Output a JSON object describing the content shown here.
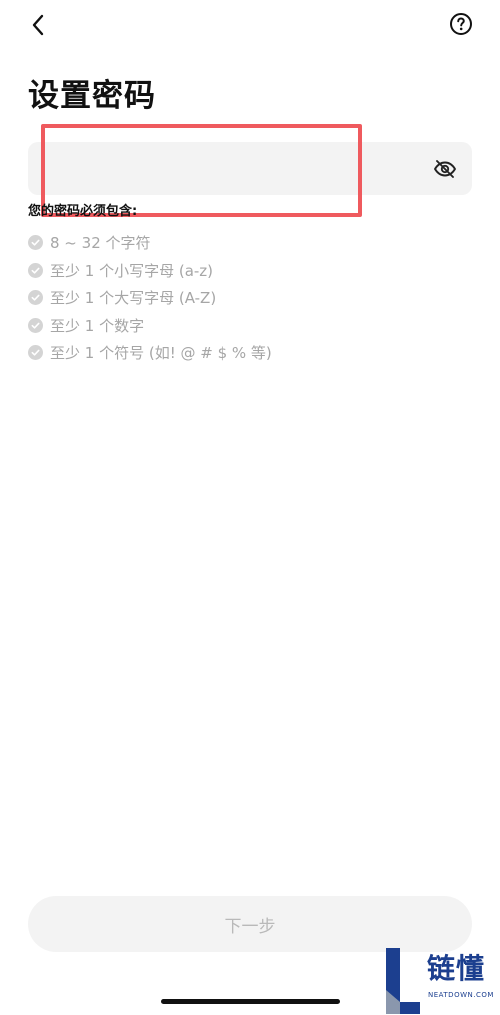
{
  "header": {
    "back_icon": "chevron-left-icon",
    "help_icon": "question-circle-icon"
  },
  "page": {
    "title": "设置密码"
  },
  "password": {
    "value": "",
    "placeholder": "",
    "visibility_icon": "eye-off-icon"
  },
  "requirements": {
    "heading": "您的密码必须包含:",
    "items": [
      "8 ~ 32 个字符",
      "至少 1 个小写字母 (a-z)",
      "至少 1 个大写字母 (A-Z)",
      "至少 1 个数字",
      "至少 1 个符号 (如! @ # $ % 等)"
    ],
    "check_color": "#d4d4d4"
  },
  "footer": {
    "next_label": "下一步"
  },
  "annotation": {
    "highlight_color": "#ef5a5e"
  },
  "watermark": {
    "text": "链懂",
    "subtext": "NEATDOWN.COM"
  }
}
